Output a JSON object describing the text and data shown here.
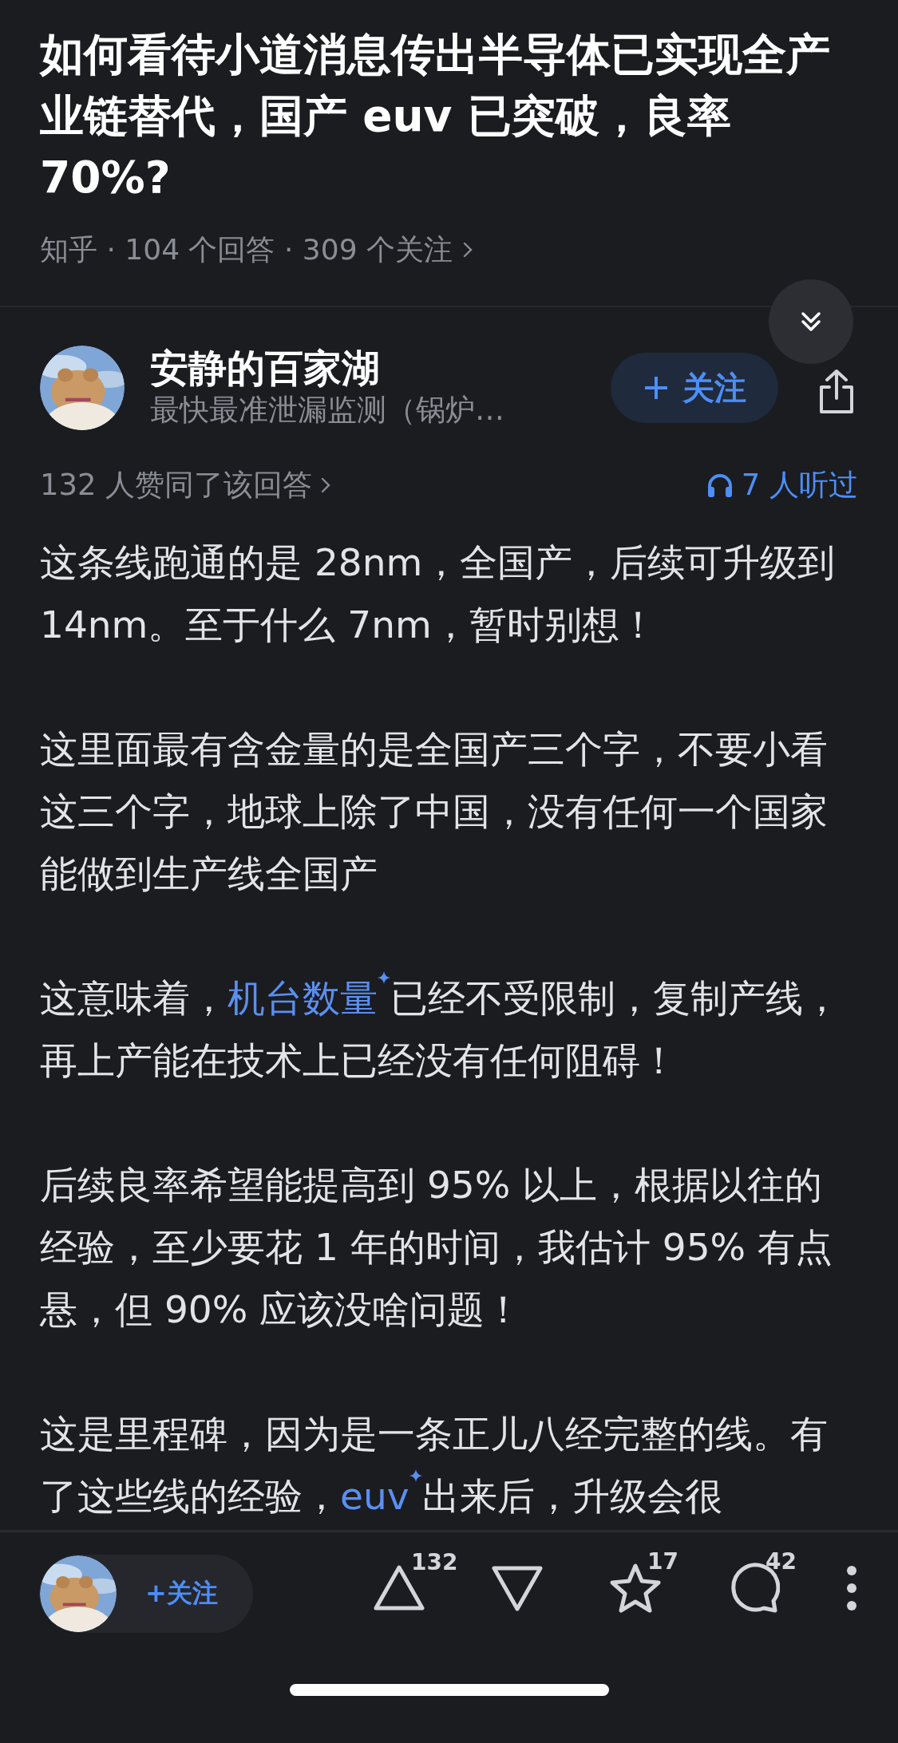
{
  "question": {
    "title": "如何看待小道消息传出半导体已实现全产业链替代，国产 euv 已突破，良率 70%?",
    "meta": "知乎 · 104 个回答 · 309 个关注"
  },
  "answer": {
    "author": {
      "name": "安静的百家湖",
      "bio": "最快最准泄漏监测（锅炉…",
      "follow_label": "关注"
    },
    "upvote_summary": "132 人赞同了该回答",
    "listen_count": "7 人听过",
    "paragraphs": [
      [
        {
          "kind": "text",
          "text": "这条线跑通的是 28nm，全国产，后续可升级到 14nm。至于什么 7nm，暂时别想！"
        }
      ],
      [
        {
          "kind": "text",
          "text": "这里面最有含金量的是全国产三个字，不要小看这三个字，地球上除了中国，没有任何一个国家能做到生产线全国产"
        }
      ],
      [
        {
          "kind": "text",
          "text": "这意味着，"
        },
        {
          "kind": "link",
          "text": "机台数量"
        },
        {
          "kind": "text",
          "text": "已经不受限制，复制产线，再上产能在技术上已经没有任何阻碍！"
        }
      ],
      [
        {
          "kind": "text",
          "text": "后续良率希望能提高到 95% 以上，根据以往的经验，至少要花 1 年的时间，我估计 95% 有点悬，但 90% 应该没啥问题！"
        }
      ],
      [
        {
          "kind": "text",
          "text": "这是里程碑，因为是一条正儿八经完整的线。有了这些线的经验，"
        },
        {
          "kind": "link",
          "text": "euv"
        },
        {
          "kind": "text",
          "text": "出来后，升级会很"
        }
      ]
    ]
  },
  "bottom_bar": {
    "follow_label": "+关注",
    "actions": [
      {
        "kind": "upvote",
        "count": "132"
      },
      {
        "kind": "downvote"
      },
      {
        "kind": "favorite",
        "count": "17"
      },
      {
        "kind": "comment",
        "count": "42"
      },
      {
        "kind": "more"
      }
    ]
  }
}
